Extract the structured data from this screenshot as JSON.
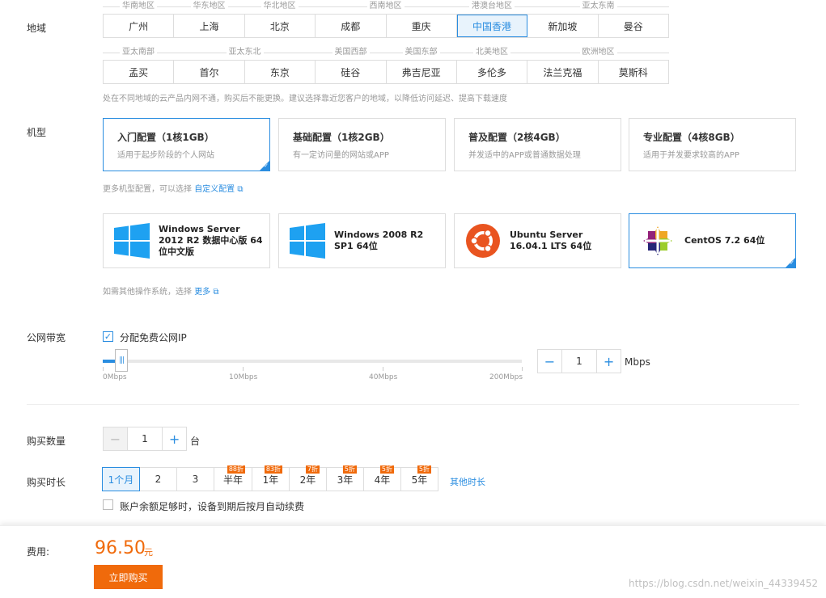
{
  "region": {
    "label": "地域",
    "groups_row1": [
      "华南地区",
      "华东地区",
      "华北地区",
      "西南地区",
      "港澳台地区",
      "亚太东南"
    ],
    "row1": [
      "广州",
      "上海",
      "北京",
      "成都",
      "重庆",
      "中国香港",
      "新加坡",
      "曼谷"
    ],
    "groups_row2": [
      "亚太南部",
      "亚太东北",
      "美国西部",
      "美国东部",
      "北美地区",
      "欧洲地区"
    ],
    "row2": [
      "孟买",
      "首尔",
      "东京",
      "硅谷",
      "弗吉尼亚",
      "多伦多",
      "法兰克福",
      "莫斯科"
    ],
    "selected": "中国香港",
    "hint": "处在不同地域的云产品内网不通，购买后不能更换。建议选择靠近您客户的地域，以降低访问延迟、提高下载速度"
  },
  "model": {
    "label": "机型",
    "cards": [
      {
        "title": "入门配置（1核1GB）",
        "desc": "适用于起步阶段的个人网站"
      },
      {
        "title": "基础配置（1核2GB）",
        "desc": "有一定访问量的网站或APP"
      },
      {
        "title": "普及配置（2核4GB）",
        "desc": "并发适中的APP或普通数据处理"
      },
      {
        "title": "专业配置（4核8GB）",
        "desc": "适用于并发要求较高的APP"
      }
    ],
    "more_text": "更多机型配置，可以选择",
    "more_link": "自定义配置"
  },
  "os": {
    "cards": [
      {
        "name": "Windows Server 2012 R2 数据中心版 64位中文版",
        "icon": "windows-icon"
      },
      {
        "name": "Windows 2008 R2 SP1 64位",
        "icon": "windows-icon"
      },
      {
        "name": "Ubuntu Server 16.04.1 LTS 64位",
        "icon": "ubuntu-icon"
      },
      {
        "name": "CentOS 7.2 64位",
        "icon": "centos-icon"
      }
    ],
    "more_text": "如需其他操作系统，选择",
    "more_link": "更多"
  },
  "bandwidth": {
    "label": "公网带宽",
    "checkbox_label": "分配免费公网IP",
    "checked": true,
    "ticks": [
      "0Mbps",
      "10Mbps",
      "40Mbps",
      "200Mbps"
    ],
    "thumb_glyph": "|||",
    "value": "1",
    "unit": "Mbps",
    "minus": "−",
    "plus": "+"
  },
  "quantity": {
    "label": "购买数量",
    "value": "1",
    "unit": "台",
    "minus": "−",
    "plus": "+"
  },
  "duration": {
    "label": "购买时长",
    "options": [
      {
        "label": "1个月",
        "badge": ""
      },
      {
        "label": "2",
        "badge": ""
      },
      {
        "label": "3",
        "badge": ""
      },
      {
        "label": "半年",
        "badge": "88折"
      },
      {
        "label": "1年",
        "badge": "83折"
      },
      {
        "label": "2年",
        "badge": "7折"
      },
      {
        "label": "3年",
        "badge": "5折"
      },
      {
        "label": "4年",
        "badge": "5折"
      },
      {
        "label": "5年",
        "badge": "5折"
      }
    ],
    "other_link": "其他时长",
    "auto_renew_label": "账户余额足够时，设备到期后按月自动续费"
  },
  "footer": {
    "cost_label": "费用:",
    "price": "96.50",
    "currency": "元",
    "buy_label": "立即购买",
    "watermark": "https://blog.csdn.net/weixin_44339452"
  },
  "colors": {
    "accent": "#2a8de0",
    "orange": "#f06a0b"
  }
}
